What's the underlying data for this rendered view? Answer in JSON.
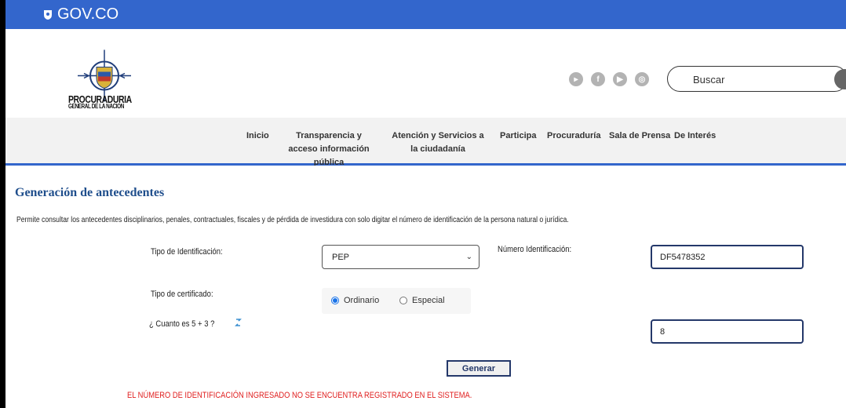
{
  "gov_bar": {
    "brand": "GOV.CO"
  },
  "header": {
    "logo_line1": "PROCURADURIA",
    "logo_line2": "GENERAL DE LA NACION",
    "search_placeholder": "Buscar",
    "social_icons": [
      "youtube-icon",
      "facebook-icon",
      "play-icon",
      "instagram-icon"
    ]
  },
  "nav": {
    "items": [
      {
        "label": "Inicio"
      },
      {
        "label": "Transparencia y acceso información pública"
      },
      {
        "label": "Atención y Servicios a la ciudadanía"
      },
      {
        "label": "Participa"
      },
      {
        "label": "Procuraduría"
      },
      {
        "label": "Sala de Prensa"
      },
      {
        "label": "De Interés"
      }
    ]
  },
  "form": {
    "title": "Generación de antecedentes",
    "description": "Permite consultar los antecedentes disciplinarios, penales, contractuales, fiscales y de pérdida de investidura con solo digitar el número de identificación de la persona natural o jurídica.",
    "tipo_id_label": "Tipo de Identificación:",
    "tipo_id_value": "PEP",
    "numero_id_label": "Número Identificación:",
    "numero_id_value": "DF5478352",
    "tipo_cert_label": "Tipo de certificado:",
    "option_ordinario": "Ordinario",
    "option_especial": "Especial",
    "captcha_question": "¿ Cuanto es 5 + 3 ?",
    "captcha_answer": "8",
    "submit_label": "Generar",
    "error_message": "EL NÚMERO DE IDENTIFICACIÓN INGRESADO NO SE ENCUENTRA REGISTRADO EN EL SISTEMA."
  },
  "colors": {
    "gov_blue": "#3366cc",
    "title_blue": "#1f4e8c",
    "error_red": "#e02020"
  }
}
